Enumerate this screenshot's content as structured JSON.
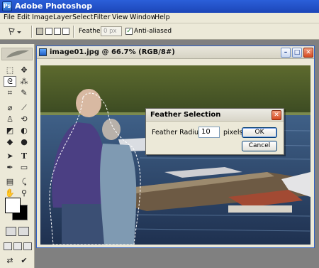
{
  "app": {
    "title": "Adobe Photoshop",
    "icon_label": "Ps"
  },
  "menu": [
    "File",
    "Edit",
    "Image",
    "Layer",
    "Select",
    "Filter",
    "View",
    "Window",
    "Help"
  ],
  "options": {
    "feather_label": "Feather:",
    "feather_value": "0 px",
    "antialiased_label": "Anti-aliased",
    "antialiased_checked": true
  },
  "document": {
    "title": "image01.jpg @ 66.7% (RGB/8#)"
  },
  "dialog": {
    "title": "Feather Selection",
    "radius_label": "Feather Radius:",
    "radius_value": "10",
    "radius_unit": "pixels",
    "ok_label": "OK",
    "cancel_label": "Cancel"
  },
  "toolbox": {
    "tools": [
      "marquee-tool",
      "move-tool",
      "lasso-tool",
      "magic-wand-tool",
      "crop-tool",
      "slice-tool",
      "healing-brush-tool",
      "brush-tool",
      "clone-stamp-tool",
      "history-brush-tool",
      "eraser-tool",
      "gradient-tool",
      "blur-tool",
      "dodge-tool",
      "path-selection-tool",
      "type-tool",
      "pen-tool",
      "shape-tool",
      "notes-tool",
      "eyedropper-tool",
      "hand-tool",
      "zoom-tool"
    ],
    "type_glyph": "T"
  }
}
